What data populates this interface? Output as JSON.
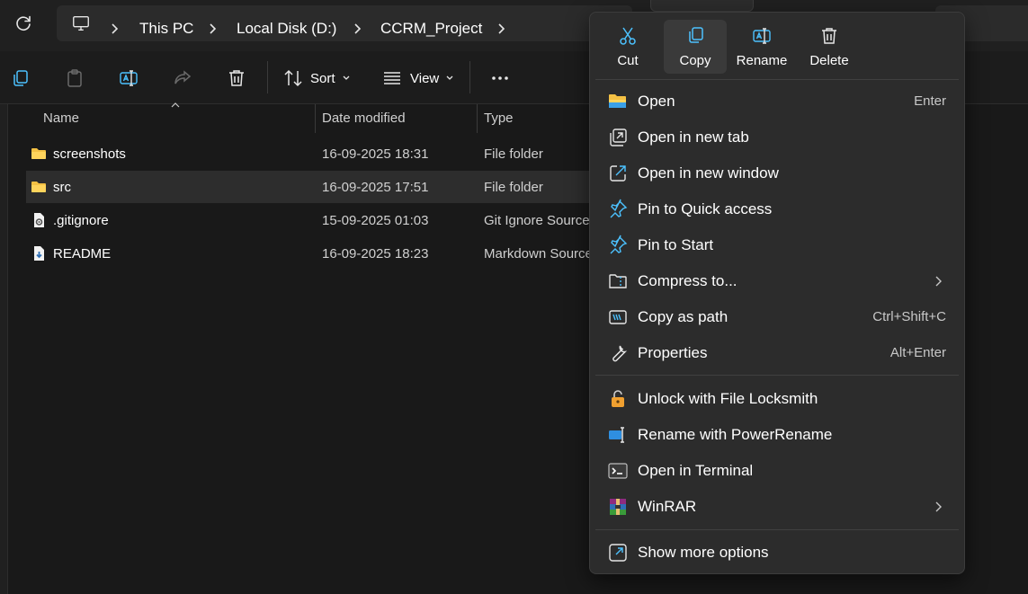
{
  "breadcrumb": {
    "items": [
      "This PC",
      "Local Disk (D:)",
      "CCRM_Project"
    ]
  },
  "toolbar": {
    "sort_label": "Sort",
    "view_label": "View"
  },
  "columns": {
    "name": "Name",
    "date": "Date modified",
    "type": "Type"
  },
  "files": [
    {
      "name": "screenshots",
      "date": "16-09-2025 18:31",
      "type": "File folder",
      "icon": "folder-icon"
    },
    {
      "name": "src",
      "date": "16-09-2025 17:51",
      "type": "File folder",
      "icon": "folder-icon"
    },
    {
      "name": ".gitignore",
      "date": "15-09-2025 01:03",
      "type": "Git Ignore Source",
      "icon": "gear-file-icon"
    },
    {
      "name": "README",
      "date": "16-09-2025 18:23",
      "type": "Markdown Source",
      "icon": "markdown-file-icon"
    }
  ],
  "context_menu": {
    "quick_actions": [
      {
        "label": "Cut",
        "icon": "scissors-icon"
      },
      {
        "label": "Copy",
        "icon": "copy-icon"
      },
      {
        "label": "Rename",
        "icon": "rename-icon"
      },
      {
        "label": "Delete",
        "icon": "trash-icon"
      }
    ],
    "items": [
      {
        "label": "Open",
        "shortcut": "Enter"
      },
      {
        "label": "Open in new tab",
        "shortcut": ""
      },
      {
        "label": "Open in new window",
        "shortcut": ""
      },
      {
        "label": "Pin to Quick access",
        "shortcut": ""
      },
      {
        "label": "Pin to Start",
        "shortcut": ""
      },
      {
        "label": "Compress to...",
        "shortcut": ""
      },
      {
        "label": "Copy as path",
        "shortcut": "Ctrl+Shift+C"
      },
      {
        "label": "Properties",
        "shortcut": "Alt+Enter"
      },
      {
        "label": "Unlock with File Locksmith",
        "shortcut": ""
      },
      {
        "label": "Rename with PowerRename",
        "shortcut": ""
      },
      {
        "label": "Open in Terminal",
        "shortcut": ""
      },
      {
        "label": "WinRAR",
        "shortcut": ""
      },
      {
        "label": "Show more options",
        "shortcut": ""
      }
    ]
  },
  "colors": {
    "background": "#191919",
    "menu": "#2c2c2c",
    "accent": "#4cc2ff",
    "folder": "#f4c144"
  }
}
